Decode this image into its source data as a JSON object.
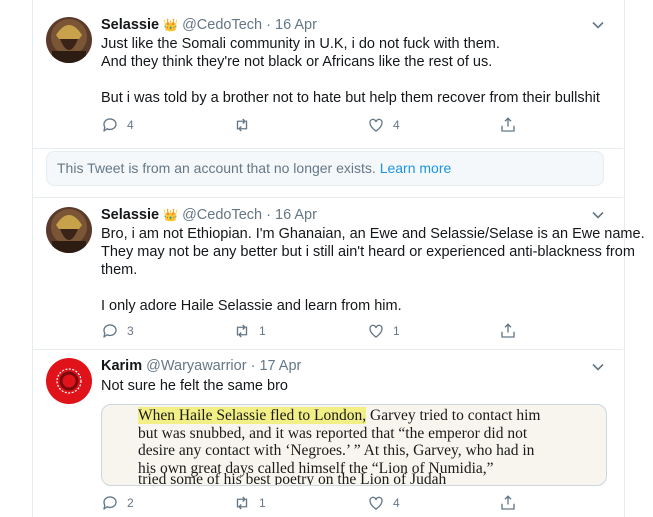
{
  "tweets": [
    {
      "name": "Selassie",
      "badge": "👑",
      "handle": "@CedoTech",
      "dot": "·",
      "date": "16 Apr",
      "lines": [
        "Just like the Somali community in U.K, i do not fuck with them.",
        "And they think they're not black or Africans like the rest of us.",
        "",
        "But i was told by a brother not to hate but help them recover from their bullshit"
      ],
      "reply_count": "4",
      "retweet_count": "",
      "like_count": "4"
    },
    {
      "name": "Selassie",
      "badge": "👑",
      "handle": "@CedoTech",
      "dot": "·",
      "date": "16 Apr",
      "lines": [
        "Bro, i am not Ethiopian. I'm Ghanaian, an Ewe and Selassie/Selase is an Ewe name.",
        "They may not be any better but i still ain't heard or experienced anti-blackness from",
        "them.",
        "",
        "I only adore Haile Selassie and learn from him."
      ],
      "reply_count": "3",
      "retweet_count": "1",
      "like_count": "1"
    },
    {
      "name": "Karim",
      "handle": "@Waryawarrior",
      "dot": "·",
      "date": "17 Apr",
      "lines": [
        "Not sure he felt the same bro"
      ],
      "reply_count": "2",
      "retweet_count": "1",
      "like_count": "4"
    }
  ],
  "notice": {
    "text": "This Tweet is from an account that no longer exists.",
    "link": "Learn more"
  },
  "media_text": {
    "highlight": "When Haile Selassie fled to London,",
    "line1_rest": " Garvey tried to contact him",
    "line2": "but was snubbed, and it was reported that “the emperor did not",
    "line3": "desire any contact with ‘Negroes.’ ” At this, Garvey, who had in",
    "line4": "his own great days called himself the “Lion of Numidia,”",
    "line5": "tried some of his best poetry on the Lion of Judah"
  },
  "colors": {
    "muted": "#657786",
    "link": "#1b95e0",
    "border": "#e6ecf0",
    "karim_avatar": "#e0121a"
  }
}
